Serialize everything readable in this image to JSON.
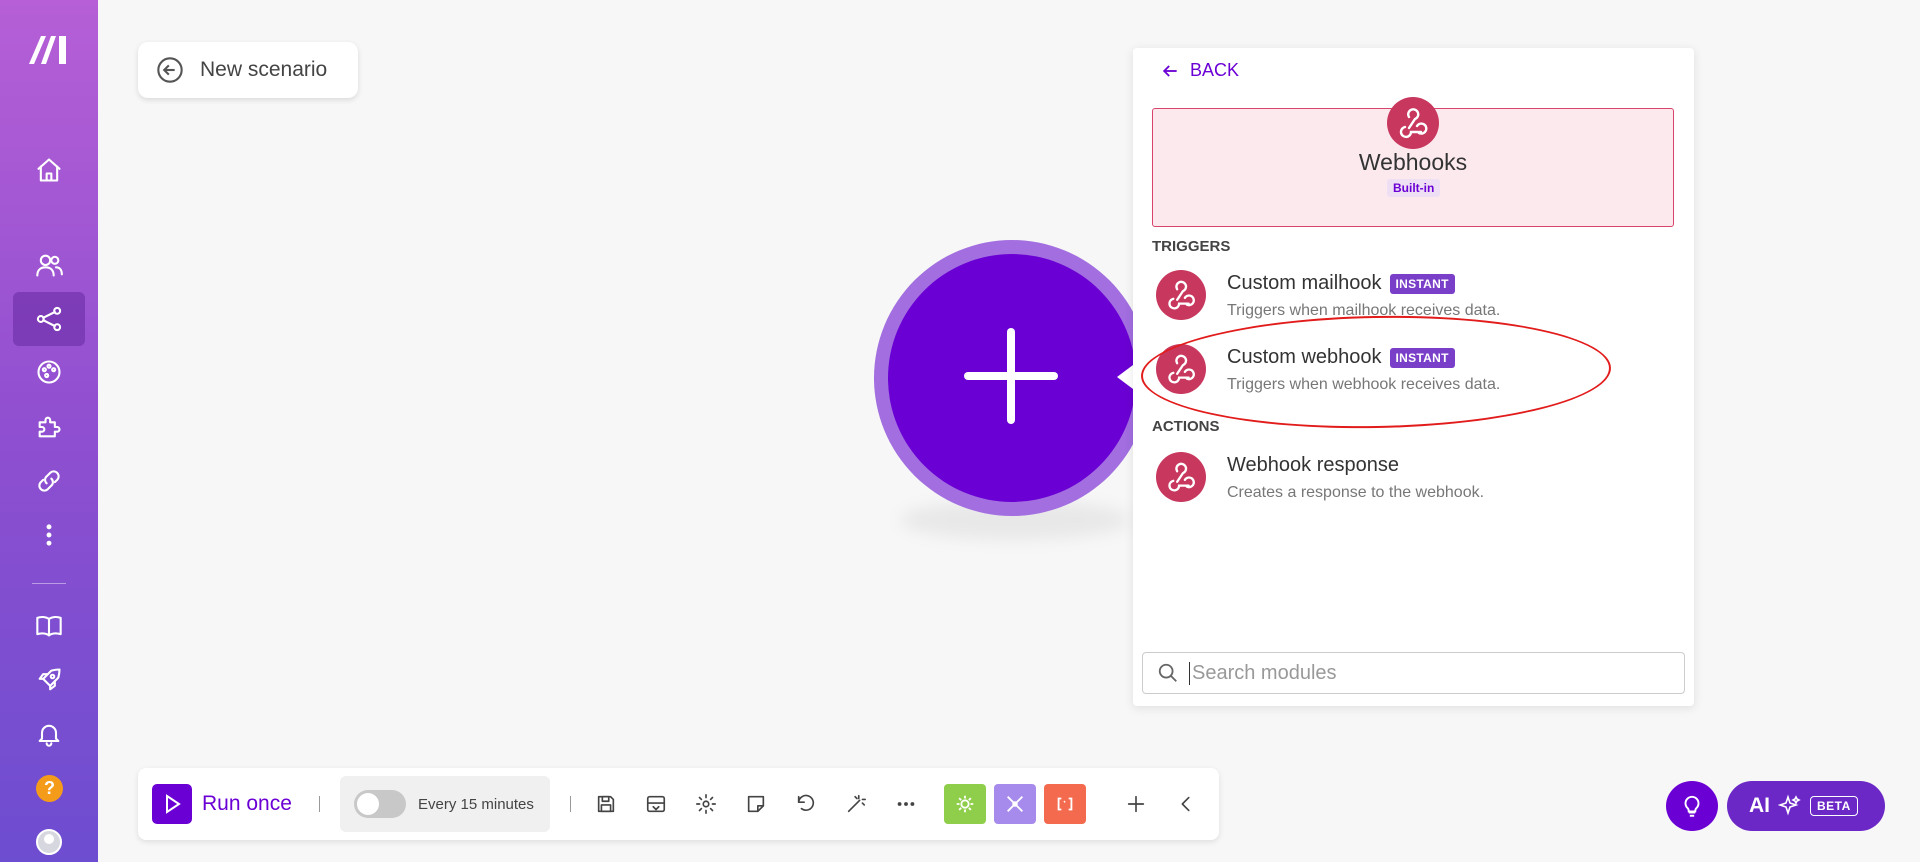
{
  "scenario": {
    "title": "New scenario"
  },
  "panel": {
    "back_label": "BACK",
    "app": {
      "name": "Webhooks",
      "badge": "Built-in"
    },
    "sections": {
      "triggers_label": "TRIGGERS",
      "actions_label": "ACTIONS"
    },
    "triggers": [
      {
        "title": "Custom mailhook",
        "badge": "INSTANT",
        "desc": "Triggers when mailhook receives data."
      },
      {
        "title": "Custom webhook",
        "badge": "INSTANT",
        "desc": "Triggers when webhook receives data."
      }
    ],
    "actions": [
      {
        "title": "Webhook response",
        "desc": "Creates a response to the webhook."
      }
    ],
    "search": {
      "placeholder": "Search modules",
      "value": ""
    }
  },
  "toolbar": {
    "run_label": "Run once",
    "schedule_label": "Every 15 minutes"
  },
  "ai": {
    "label": "AI",
    "badge": "BETA"
  },
  "help": {
    "label": "?"
  },
  "colors": {
    "brand": "#6b00d4",
    "webhook": "#c8375e",
    "highlight": "#e21b1b"
  }
}
